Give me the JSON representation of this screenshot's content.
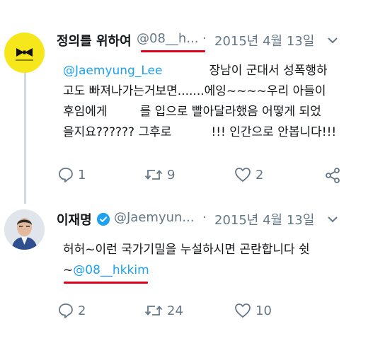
{
  "tweets": [
    {
      "display_name": "정의를 위하여",
      "handle": "@08__h...",
      "separator": "·",
      "date": "2015년 4월 13일",
      "mention": "@Jaemyung_Lee",
      "line1_rest": "장남이 군대서 성폭행하",
      "line2": "고도 빠져나가는거보면.......에잉~~~~우리 아들이",
      "line3_a": "후임에게",
      "line3_b": "를 입으로 빨아달라했음 어떻게 되었",
      "line4_a": "을지요?????? 그후로",
      "line4_b": "!!!  인간으로 안봅니다!!!",
      "replies": "1",
      "retweets": "9",
      "likes": "2",
      "icons": [
        "reply-icon",
        "retweet-icon",
        "heart-icon",
        "share-icon",
        "chevron-down-icon"
      ]
    },
    {
      "display_name": "이재명",
      "handle": "@Jaemyun...",
      "separator": "·",
      "date": "2015년 4월 13일",
      "line1": "허허~이런 국가기밀을 누설하시면 곤란합니다 쉿",
      "line2_prefix": "~",
      "mention": "@08__hkkim",
      "replies": "2",
      "retweets": "24",
      "likes": "10",
      "icons": [
        "verified-badge-icon",
        "reply-icon",
        "retweet-icon",
        "heart-icon"
      ]
    }
  ],
  "colors": {
    "mention": "#1da1f2",
    "underline": "#e0001b",
    "muted": "#657786",
    "verified": "#1da1f2"
  }
}
